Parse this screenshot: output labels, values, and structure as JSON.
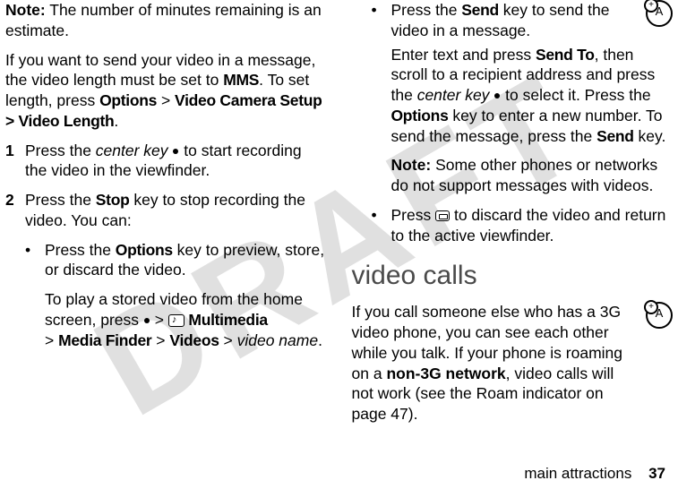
{
  "watermark": "DRAFT",
  "col1": {
    "note_label": "Note:",
    "note_text": " The number of minutes remaining is an estimate.",
    "mms_p1": "If you want to send your video in a message, the video length must be set to ",
    "mms_word": "MMS",
    "mms_p2": ". To set length, press ",
    "options": "Options",
    "gt": " > ",
    "vcs": "Video Camera Setup",
    "vl": "> Video Length",
    "vl_end": ".",
    "step1_num": "1",
    "step1_a": "Press the ",
    "step1_ck": "center key",
    "step1_b": " to start recording the video in the viewfinder.",
    "step2_num": "2",
    "step2_a": "Press the ",
    "step2_stop": "Stop",
    "step2_b": " key to stop recording the video. You can:",
    "b1a": "Press the ",
    "b1_options": "Options",
    "b1b": " key to preview, store, or discard the video.",
    "play_a": "To play a stored video from the home screen, press ",
    "play_mm": " Multimedia",
    "play_b": " > ",
    "play_mf": "Media Finder",
    "play_c": " > ",
    "play_vids": "Videos",
    "play_d": " > ",
    "play_name": "video name",
    "play_end": "."
  },
  "col2": {
    "send_a": "Press the ",
    "send_key": "Send",
    "send_b": " key to send the video in a message.",
    "enter_a": "Enter text and press ",
    "sendto": "Send To",
    "enter_b": ", then scroll to a recipient address and press the ",
    "ck": "center key",
    "enter_c": " to select it. Press the ",
    "options": "Options",
    "enter_d": " key to enter a new number. To send the message, press the ",
    "send2": "Send",
    "enter_e": " key.",
    "note_label": "Note:",
    "note_text": " Some other phones or networks do not support messages with videos.",
    "discard_a": "Press ",
    "discard_b": " to discard the video and return to the active viewfinder.",
    "heading": "video calls",
    "vc_a": "If you call someone else who has a 3G video phone, you can see each other while you talk. If your phone is roaming on a ",
    "vc_bold": "non-3G network",
    "vc_b": ", video calls will not work (see the Roam indicator on page 47).",
    "badge": "A"
  },
  "footer": {
    "label": "main attractions",
    "page": "37"
  }
}
